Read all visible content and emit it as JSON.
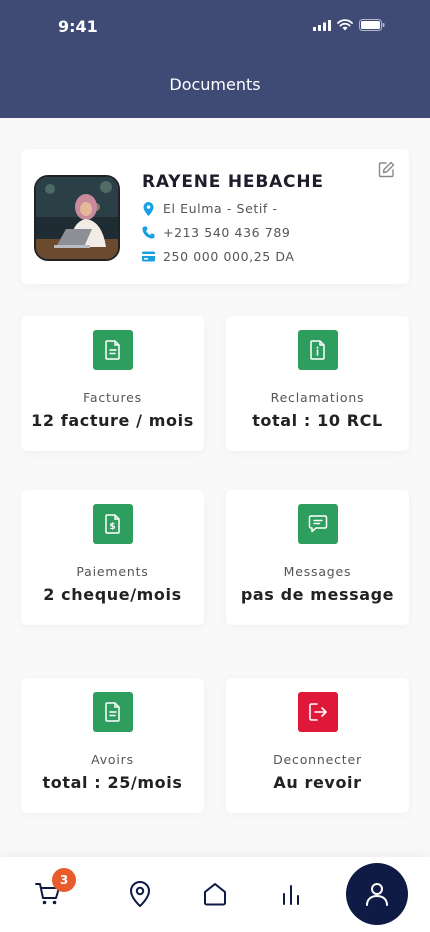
{
  "status_bar": {
    "time": "9:41"
  },
  "header": {
    "title": "Documents"
  },
  "profile": {
    "name": "RAYENE HEBACHE",
    "location": "El Eulma - Setif -",
    "phone": "+213 540 436 789",
    "balance": "250 000 000,25 DA"
  },
  "tiles": [
    {
      "label": "Factures",
      "value": "12 facture / mois",
      "icon": "invoice-icon",
      "color": "#2e9e5e"
    },
    {
      "label": "Reclamations",
      "value": "total : 10 RCL",
      "icon": "info-document-icon",
      "color": "#2e9e5e"
    },
    {
      "label": "Paiements",
      "value": "2 cheque/mois",
      "icon": "dollar-document-icon",
      "color": "#2e9e5e"
    },
    {
      "label": "Messages",
      "value": "pas de message",
      "icon": "message-icon",
      "color": "#2e9e5e"
    },
    {
      "label": "Avoirs",
      "value": "total : 25/mois",
      "icon": "credit-note-icon",
      "color": "#2e9e5e"
    },
    {
      "label": "Deconnecter",
      "value": "Au revoir",
      "icon": "logout-icon",
      "color": "#e0183a"
    }
  ],
  "bottom_nav": {
    "cart_badge": "3",
    "items": [
      "cart-icon",
      "location-icon",
      "home-icon",
      "stats-icon",
      "profile-icon"
    ]
  }
}
